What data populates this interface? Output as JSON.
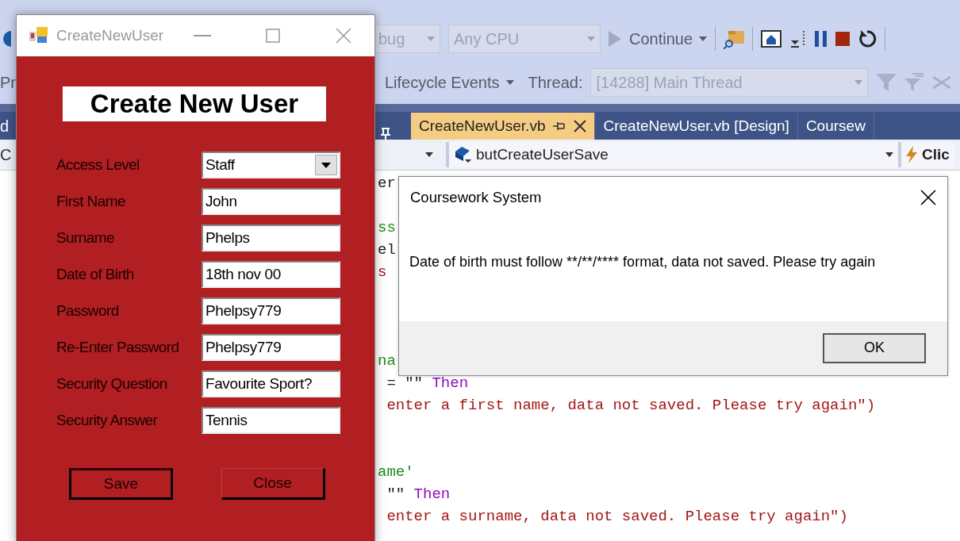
{
  "ide": {
    "left_edge": {
      "row_text": "Pr",
      "tab_text": "d",
      "nav_text": "C"
    },
    "toolbar": {
      "configuration": "bug",
      "platform": "Any CPU",
      "continue": "Continue"
    },
    "debug_location": {
      "lifecycle": "Lifecycle Events",
      "thread_label": "Thread:",
      "thread": "[14288] Main Thread"
    },
    "tabs": [
      {
        "label": "CreateNewUser.vb",
        "selected": true
      },
      {
        "label": "CreateNewUser.vb [Design]",
        "selected": false
      },
      {
        "label": "Coursew",
        "selected": false
      }
    ],
    "navigation": {
      "member": "butCreateUserSave",
      "event": "Clic"
    },
    "code_lines": [
      {
        "kind": "code",
        "segments": [
          {
            "text": "er",
            "kind": "plain"
          }
        ]
      },
      {
        "kind": "blank"
      },
      {
        "kind": "code",
        "segments": [
          {
            "text": "ss",
            "kind": "comment"
          }
        ]
      },
      {
        "kind": "code",
        "segments": [
          {
            "text": "el",
            "kind": "plain"
          }
        ]
      },
      {
        "kind": "code",
        "segments": [
          {
            "text": "s",
            "kind": "string"
          }
        ]
      },
      {
        "kind": "blank"
      },
      {
        "kind": "blank"
      },
      {
        "kind": "blank"
      },
      {
        "kind": "code",
        "segments": [
          {
            "text": "na",
            "kind": "comment"
          }
        ]
      },
      {
        "kind": "code",
        "segments": [
          {
            "text": " = \"\" ",
            "kind": "plain"
          },
          {
            "text": "Then",
            "kind": "keyword"
          }
        ]
      },
      {
        "kind": "code",
        "segments": [
          {
            "text": " enter a first name, data not saved. Please try again\")",
            "kind": "string"
          }
        ]
      },
      {
        "kind": "blank"
      },
      {
        "kind": "blank"
      },
      {
        "kind": "code",
        "segments": [
          {
            "text": "ame'",
            "kind": "comment"
          }
        ]
      },
      {
        "kind": "code",
        "segments": [
          {
            "text": " \"\" ",
            "kind": "plain"
          },
          {
            "text": "Then",
            "kind": "keyword"
          }
        ]
      },
      {
        "kind": "code",
        "segments": [
          {
            "text": " enter a surname, data not saved. Please try again\")",
            "kind": "string"
          }
        ]
      }
    ]
  },
  "form": {
    "title": "CreateNewUser",
    "heading": "Create New User",
    "fields": [
      {
        "label": "Access Level",
        "value": "Staff",
        "kind": "dropdown"
      },
      {
        "label": "First Name",
        "value": "John",
        "kind": "text"
      },
      {
        "label": "Surname",
        "value": "Phelps",
        "kind": "text"
      },
      {
        "label": "Date of Birth",
        "value": "18th nov 00",
        "kind": "text"
      },
      {
        "label": "Password",
        "value": "Phelpsy779",
        "kind": "text"
      },
      {
        "label": "Re-Enter Password",
        "value": "Phelpsy779",
        "kind": "text"
      },
      {
        "label": "Security Question",
        "value": "Favourite Sport?",
        "kind": "text"
      },
      {
        "label": "Security Answer",
        "value": "Tennis",
        "kind": "text"
      }
    ],
    "buttons": [
      {
        "label": "Save",
        "default": true
      },
      {
        "label": "Close",
        "default": false
      }
    ]
  },
  "message_box": {
    "title": "Coursework System",
    "message": "Date of birth must follow **/**/**** format, data not saved. Please try again",
    "buttons": [
      "OK"
    ]
  }
}
